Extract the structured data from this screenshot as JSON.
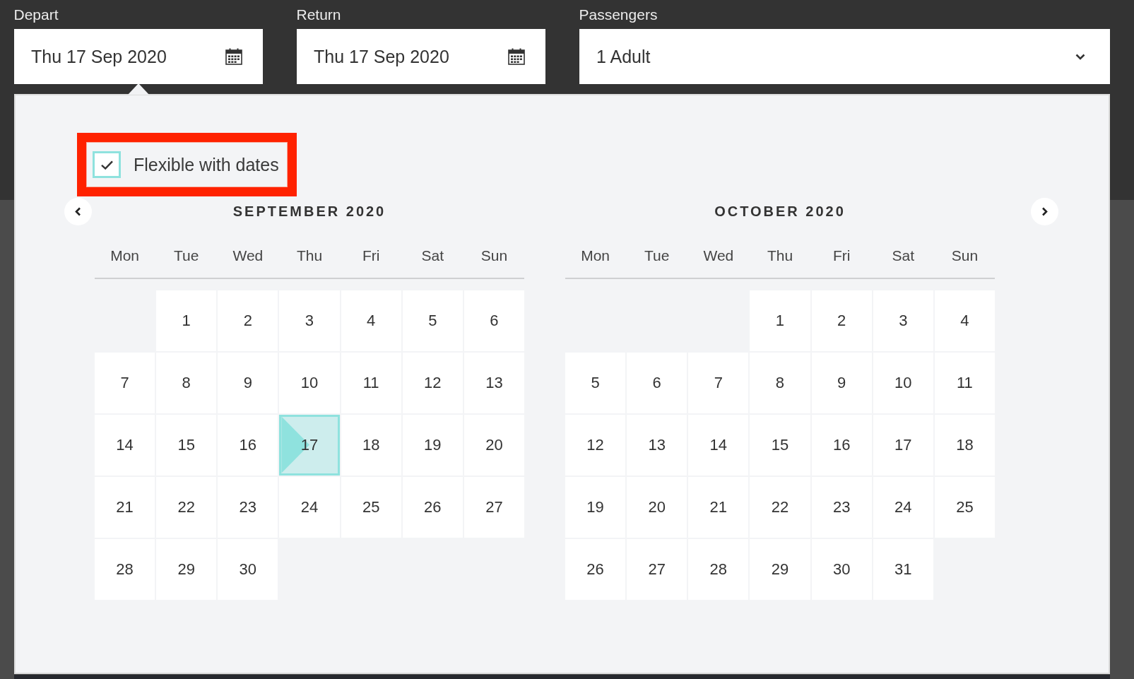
{
  "search_form": {
    "fields": [
      {
        "kind": "date",
        "label": "Depart",
        "value": "Thu 17 Sep 2020",
        "expanded": true
      },
      {
        "kind": "date",
        "label": "Return",
        "value": "Thu 17 Sep 2020",
        "expanded": false
      },
      {
        "kind": "select",
        "label": "Passengers",
        "value": "1 Adult",
        "expanded": false
      }
    ]
  },
  "date_picker": {
    "flexible_dates": {
      "label": "Flexible with dates",
      "checked": true,
      "highlighted": true
    },
    "months": [
      {
        "title": "SEPTEMBER 2020",
        "weekdays": [
          "Mon",
          "Tue",
          "Wed",
          "Thu",
          "Fri",
          "Sat",
          "Sun"
        ],
        "cells": [
          {
            "kind": "blank"
          },
          {
            "kind": "day",
            "day": "1",
            "selected": false
          },
          {
            "kind": "day",
            "day": "2",
            "selected": false
          },
          {
            "kind": "day",
            "day": "3",
            "selected": false
          },
          {
            "kind": "day",
            "day": "4",
            "selected": false
          },
          {
            "kind": "day",
            "day": "5",
            "selected": false
          },
          {
            "kind": "day",
            "day": "6",
            "selected": false
          },
          {
            "kind": "day",
            "day": "7",
            "selected": false
          },
          {
            "kind": "day",
            "day": "8",
            "selected": false
          },
          {
            "kind": "day",
            "day": "9",
            "selected": false
          },
          {
            "kind": "day",
            "day": "10",
            "selected": false
          },
          {
            "kind": "day",
            "day": "11",
            "selected": false
          },
          {
            "kind": "day",
            "day": "12",
            "selected": false
          },
          {
            "kind": "day",
            "day": "13",
            "selected": false
          },
          {
            "kind": "day",
            "day": "14",
            "selected": false
          },
          {
            "kind": "day",
            "day": "15",
            "selected": false
          },
          {
            "kind": "day",
            "day": "16",
            "selected": false
          },
          {
            "kind": "day",
            "day": "17",
            "selected": true
          },
          {
            "kind": "day",
            "day": "18",
            "selected": false
          },
          {
            "kind": "day",
            "day": "19",
            "selected": false
          },
          {
            "kind": "day",
            "day": "20",
            "selected": false
          },
          {
            "kind": "day",
            "day": "21",
            "selected": false
          },
          {
            "kind": "day",
            "day": "22",
            "selected": false
          },
          {
            "kind": "day",
            "day": "23",
            "selected": false
          },
          {
            "kind": "day",
            "day": "24",
            "selected": false
          },
          {
            "kind": "day",
            "day": "25",
            "selected": false
          },
          {
            "kind": "day",
            "day": "26",
            "selected": false
          },
          {
            "kind": "day",
            "day": "27",
            "selected": false
          },
          {
            "kind": "day",
            "day": "28",
            "selected": false
          },
          {
            "kind": "day",
            "day": "29",
            "selected": false
          },
          {
            "kind": "day",
            "day": "30",
            "selected": false
          }
        ]
      },
      {
        "title": "OCTOBER 2020",
        "weekdays": [
          "Mon",
          "Tue",
          "Wed",
          "Thu",
          "Fri",
          "Sat",
          "Sun"
        ],
        "cells": [
          {
            "kind": "blank"
          },
          {
            "kind": "blank"
          },
          {
            "kind": "blank"
          },
          {
            "kind": "day",
            "day": "1",
            "selected": false
          },
          {
            "kind": "day",
            "day": "2",
            "selected": false
          },
          {
            "kind": "day",
            "day": "3",
            "selected": false
          },
          {
            "kind": "day",
            "day": "4",
            "selected": false
          },
          {
            "kind": "day",
            "day": "5",
            "selected": false
          },
          {
            "kind": "day",
            "day": "6",
            "selected": false
          },
          {
            "kind": "day",
            "day": "7",
            "selected": false
          },
          {
            "kind": "day",
            "day": "8",
            "selected": false
          },
          {
            "kind": "day",
            "day": "9",
            "selected": false
          },
          {
            "kind": "day",
            "day": "10",
            "selected": false
          },
          {
            "kind": "day",
            "day": "11",
            "selected": false
          },
          {
            "kind": "day",
            "day": "12",
            "selected": false
          },
          {
            "kind": "day",
            "day": "13",
            "selected": false
          },
          {
            "kind": "day",
            "day": "14",
            "selected": false
          },
          {
            "kind": "day",
            "day": "15",
            "selected": false
          },
          {
            "kind": "day",
            "day": "16",
            "selected": false
          },
          {
            "kind": "day",
            "day": "17",
            "selected": false
          },
          {
            "kind": "day",
            "day": "18",
            "selected": false
          },
          {
            "kind": "day",
            "day": "19",
            "selected": false
          },
          {
            "kind": "day",
            "day": "20",
            "selected": false
          },
          {
            "kind": "day",
            "day": "21",
            "selected": false
          },
          {
            "kind": "day",
            "day": "22",
            "selected": false
          },
          {
            "kind": "day",
            "day": "23",
            "selected": false
          },
          {
            "kind": "day",
            "day": "24",
            "selected": false
          },
          {
            "kind": "day",
            "day": "25",
            "selected": false
          },
          {
            "kind": "day",
            "day": "26",
            "selected": false
          },
          {
            "kind": "day",
            "day": "27",
            "selected": false
          },
          {
            "kind": "day",
            "day": "28",
            "selected": false
          },
          {
            "kind": "day",
            "day": "29",
            "selected": false
          },
          {
            "kind": "day",
            "day": "30",
            "selected": false
          },
          {
            "kind": "day",
            "day": "31",
            "selected": false
          }
        ]
      }
    ]
  }
}
